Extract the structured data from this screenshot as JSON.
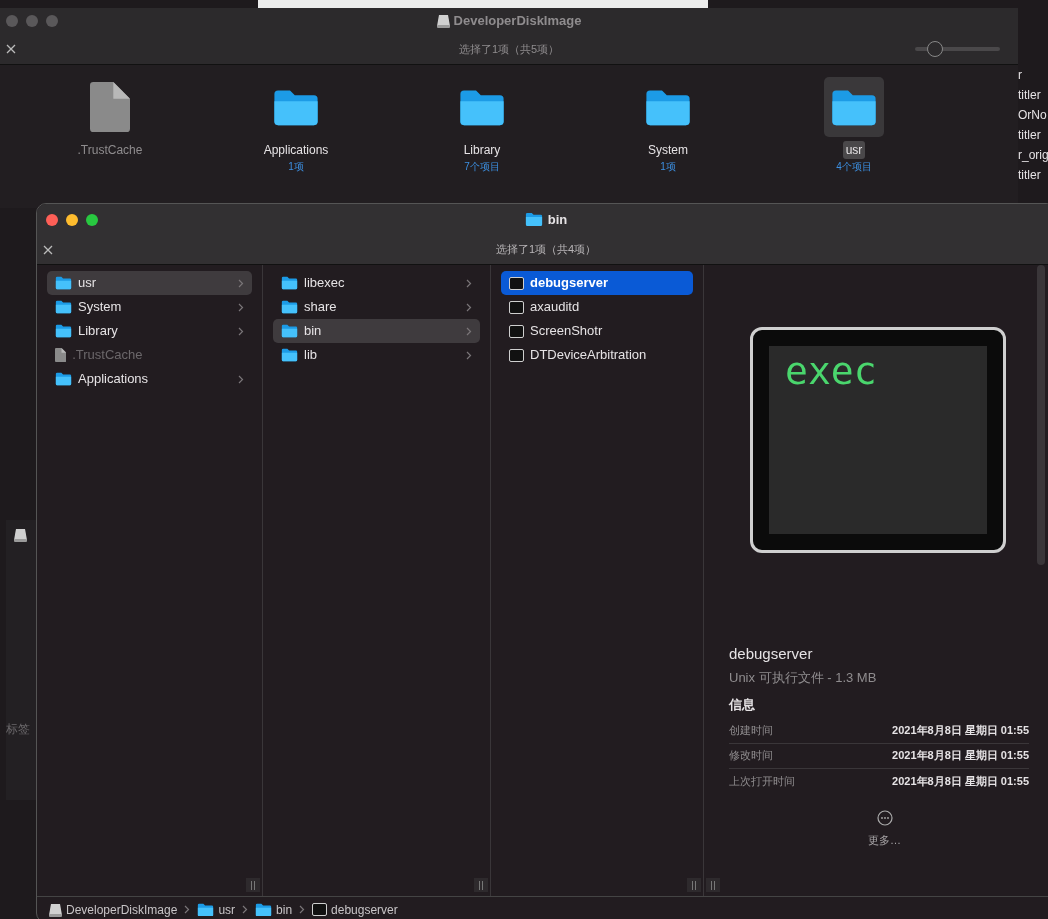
{
  "back_window": {
    "title": "DeveloperDiskImage",
    "status": "选择了1项（共5项）",
    "zoom_slider": {
      "level": 0.18
    },
    "items": [
      {
        "name": ".TrustCache",
        "kind": "file",
        "selected": false
      },
      {
        "name": "Applications",
        "count": "1项",
        "kind": "folder",
        "selected": false
      },
      {
        "name": "Library",
        "count": "7个项目",
        "kind": "folder",
        "selected": false
      },
      {
        "name": "System",
        "count": "1项",
        "kind": "folder",
        "selected": false
      },
      {
        "name": "usr",
        "count": "4个项目",
        "kind": "folder",
        "selected": true
      }
    ]
  },
  "right_edge_fragments": [
    "r",
    "titler",
    "OrNo",
    "titler",
    "r_orig",
    "titler"
  ],
  "left_edge_fragment": {
    "label": "标签"
  },
  "window": {
    "title": "bin",
    "status": "选择了1项（共4项）",
    "columns": [
      {
        "items": [
          {
            "name": "usr",
            "kind": "folder",
            "selected": true,
            "dimmed": false,
            "has_children": true
          },
          {
            "name": "System",
            "kind": "folder",
            "selected": false,
            "dimmed": false,
            "has_children": true
          },
          {
            "name": "Library",
            "kind": "folder",
            "selected": false,
            "dimmed": false,
            "has_children": true
          },
          {
            "name": ".TrustCache",
            "kind": "file",
            "selected": false,
            "dimmed": true,
            "has_children": false
          },
          {
            "name": "Applications",
            "kind": "folder",
            "selected": false,
            "dimmed": false,
            "has_children": true
          }
        ]
      },
      {
        "items": [
          {
            "name": "libexec",
            "kind": "folder",
            "selected": false,
            "dimmed": false,
            "has_children": true
          },
          {
            "name": "share",
            "kind": "folder",
            "selected": false,
            "dimmed": false,
            "has_children": true
          },
          {
            "name": "bin",
            "kind": "folder",
            "selected": true,
            "dimmed": false,
            "has_children": true
          },
          {
            "name": "lib",
            "kind": "folder",
            "selected": false,
            "dimmed": false,
            "has_children": true
          }
        ]
      },
      {
        "items": [
          {
            "name": "debugserver",
            "kind": "exec",
            "selected": true,
            "dimmed": false,
            "has_children": false
          },
          {
            "name": "axauditd",
            "kind": "exec",
            "selected": false,
            "dimmed": false,
            "has_children": false
          },
          {
            "name": "ScreenShotr",
            "kind": "exec",
            "selected": false,
            "dimmed": false,
            "has_children": false
          },
          {
            "name": "DTDeviceArbitration",
            "kind": "exec",
            "selected": false,
            "dimmed": false,
            "has_children": false
          }
        ]
      }
    ],
    "preview": {
      "icon_text": "exec",
      "name": "debugserver",
      "kind_size": "Unix 可执行文件 - 1.3 MB",
      "info_heading": "信息",
      "info": [
        {
          "label": "创建时间",
          "value": "2021年8月8日 星期日 01:55"
        },
        {
          "label": "修改时间",
          "value": "2021年8月8日 星期日 01:55"
        },
        {
          "label": "上次打开时间",
          "value": "2021年8月8日 星期日 01:55"
        }
      ],
      "more": "更多…"
    },
    "path_bar": [
      {
        "name": "DeveloperDiskImage",
        "kind": "disk"
      },
      {
        "name": "usr",
        "kind": "folder"
      },
      {
        "name": "bin",
        "kind": "folder"
      },
      {
        "name": "debugserver",
        "kind": "exec"
      }
    ]
  }
}
